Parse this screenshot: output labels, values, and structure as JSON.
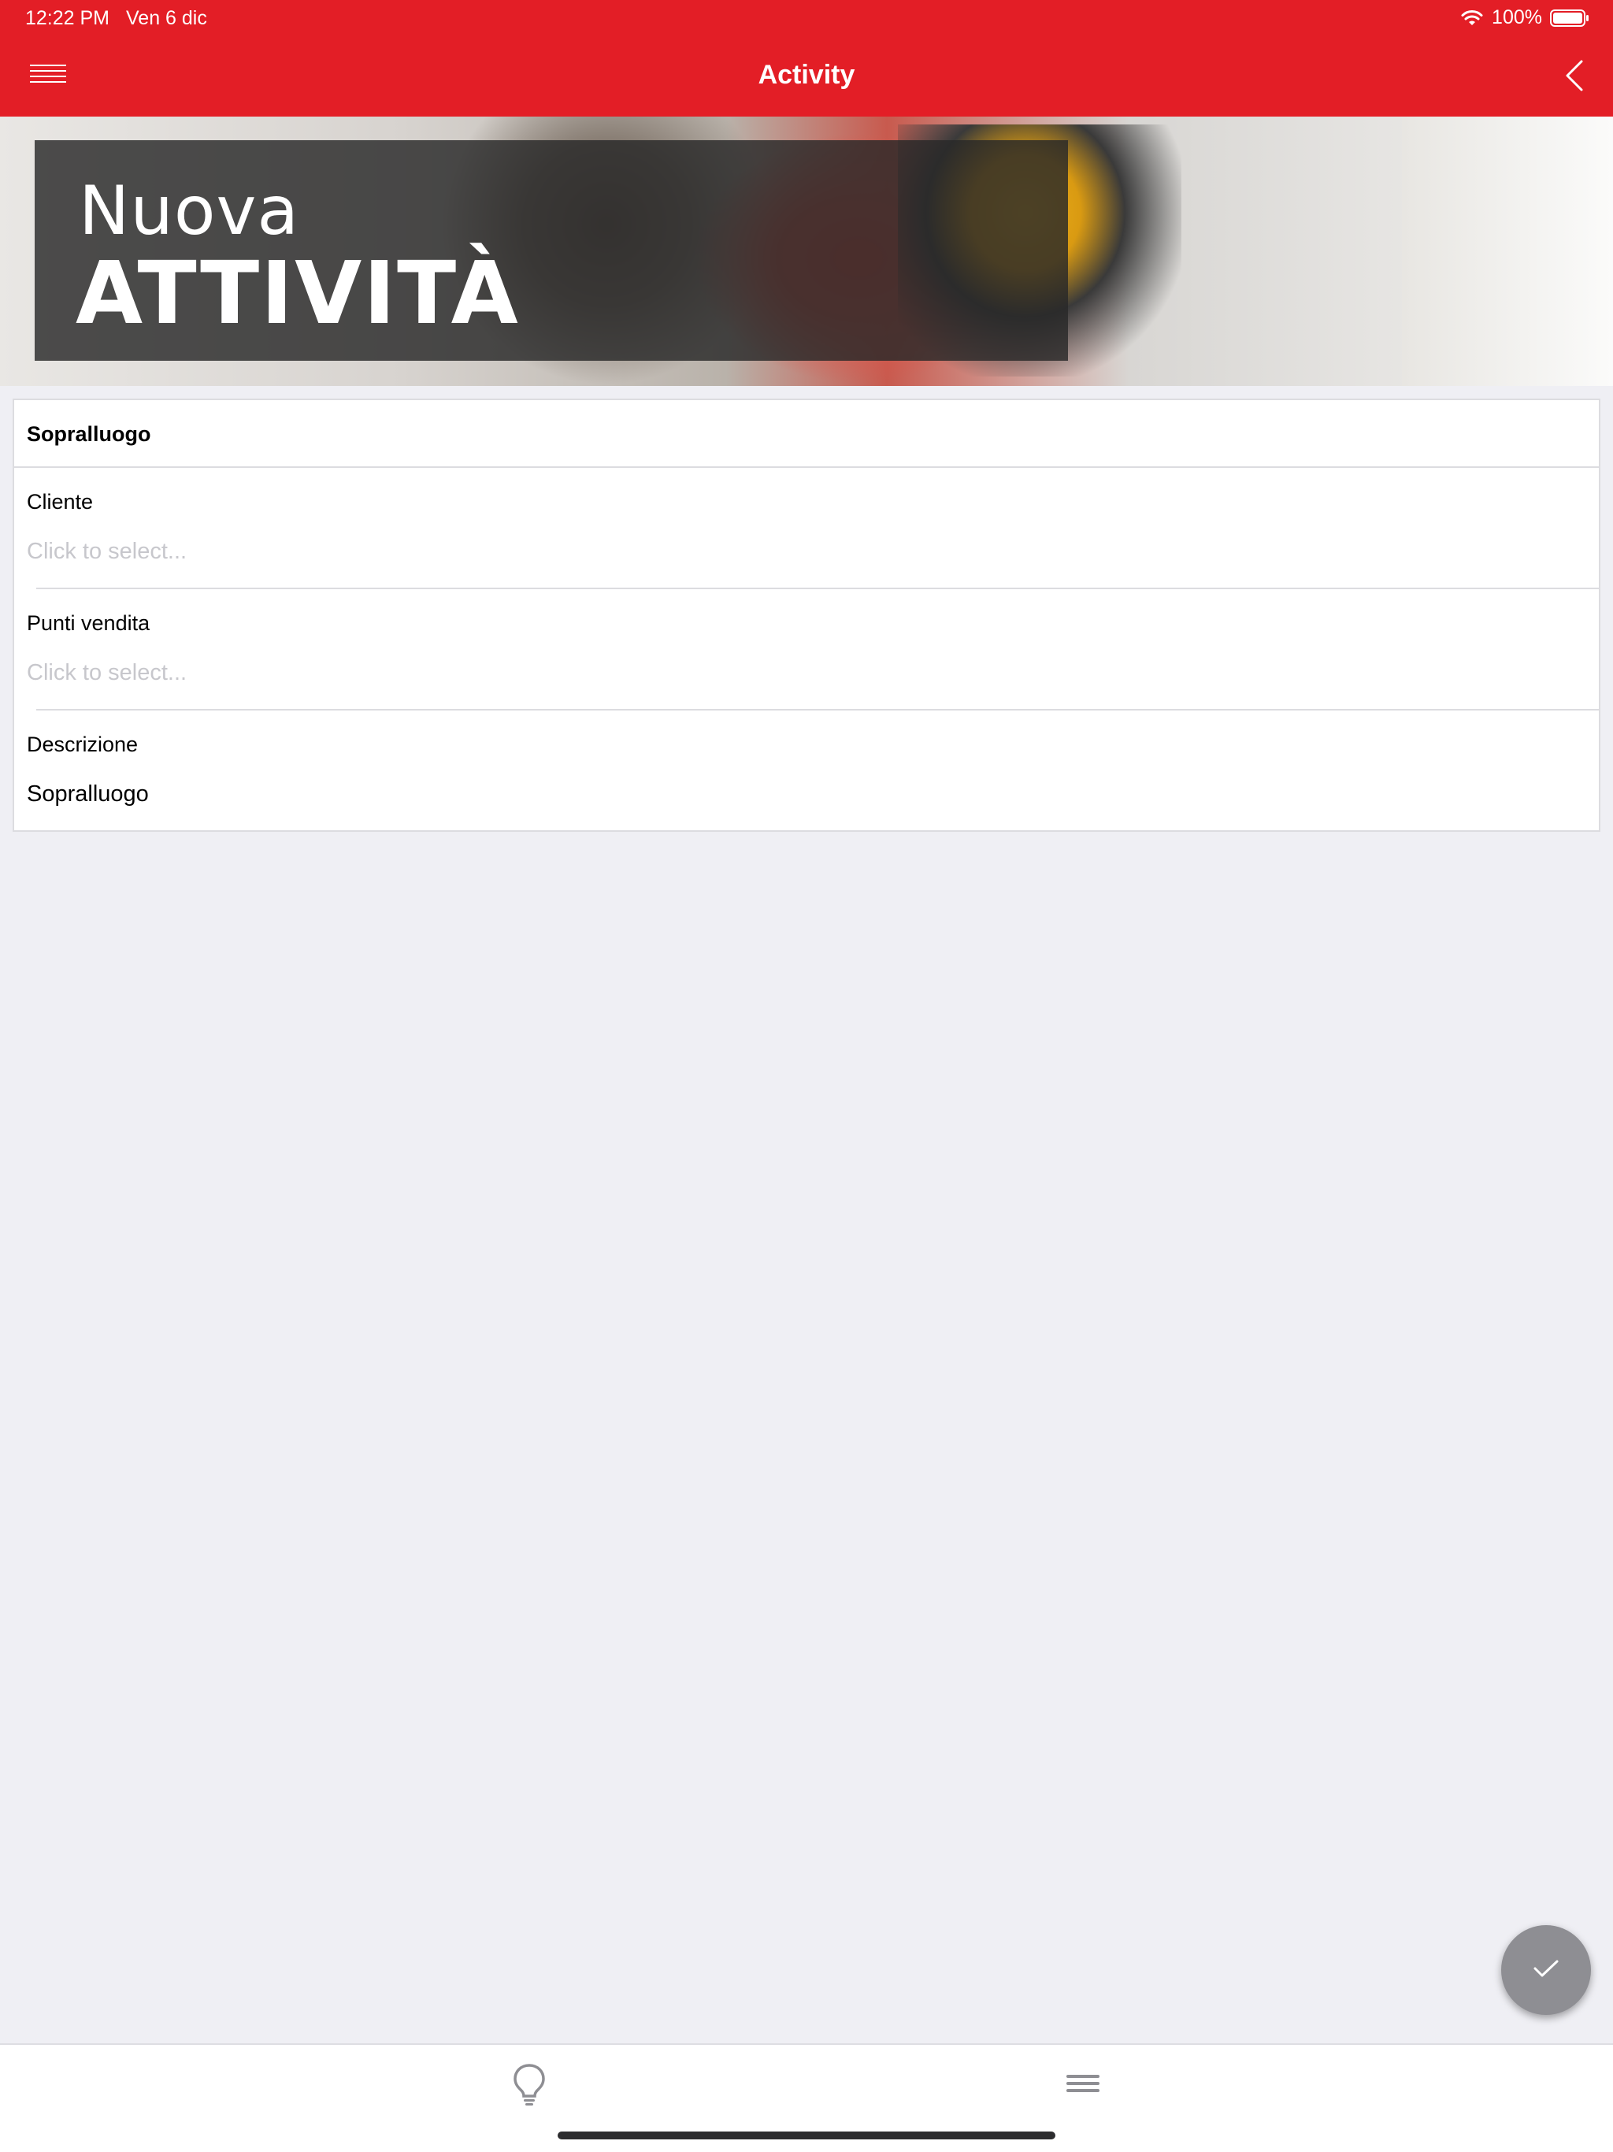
{
  "status_bar": {
    "time": "12:22 PM",
    "date": "Ven 6 dic",
    "battery": "100%"
  },
  "header": {
    "title": "Activity",
    "menu_icon": "hamburger-menu-icon",
    "back_icon": "chevron-left-icon",
    "background_color": "#e31e26"
  },
  "banner": {
    "line1": "Nuova",
    "line2": "ATTIVITÀ"
  },
  "form": {
    "section_title": "Sopralluogo",
    "fields": [
      {
        "label": "Cliente",
        "placeholder": "Click to select..."
      },
      {
        "label": "Punti vendita",
        "placeholder": "Click to select..."
      },
      {
        "label": "Descrizione",
        "value": "Sopralluogo"
      }
    ]
  },
  "fab": {
    "icon": "checkmark-icon"
  },
  "tabbar": {
    "items": [
      {
        "icon": "lightbulb-icon"
      },
      {
        "icon": "list-icon"
      }
    ]
  }
}
